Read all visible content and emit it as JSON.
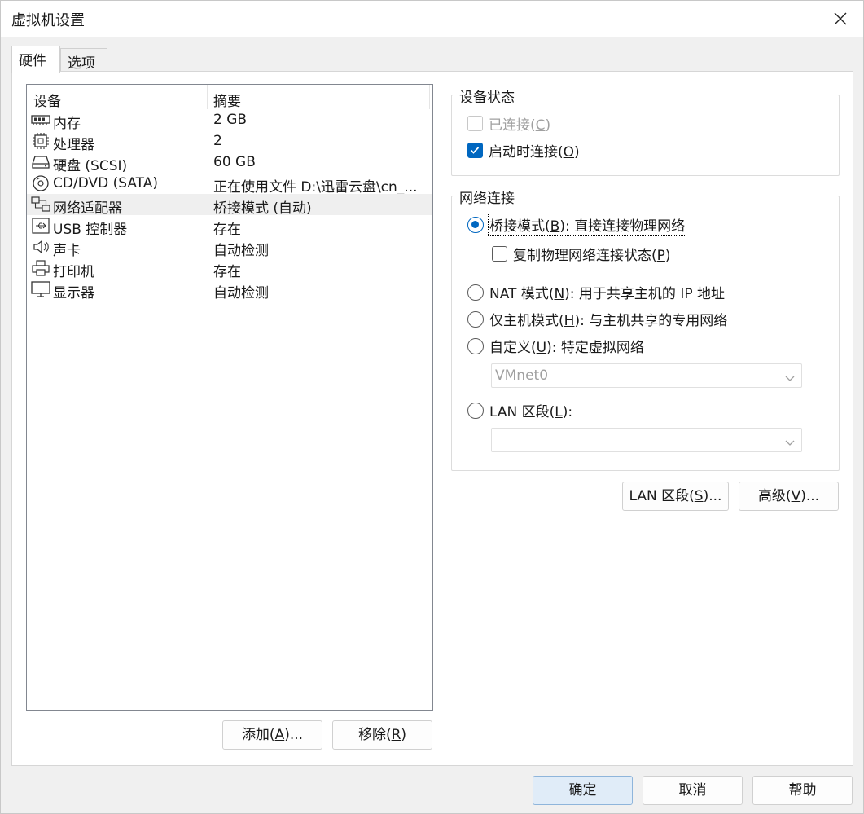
{
  "window": {
    "title": "虚拟机设置"
  },
  "tabs": {
    "hardware": "硬件",
    "options": "选项"
  },
  "device_list": {
    "col_device": "设备",
    "col_summary": "摘要",
    "rows": [
      {
        "icon": "memory-icon",
        "name": "内存",
        "summary": "2 GB"
      },
      {
        "icon": "processor-icon",
        "name": "处理器",
        "summary": "2"
      },
      {
        "icon": "harddisk-icon",
        "name": "硬盘 (SCSI)",
        "summary": "60 GB"
      },
      {
        "icon": "cd-dvd-icon",
        "name": "CD/DVD (SATA)",
        "summary": "正在使用文件 D:\\迅雷云盘\\cn_..."
      },
      {
        "icon": "network-adapter-icon",
        "name": "网络适配器",
        "summary": "桥接模式 (自动)"
      },
      {
        "icon": "usb-icon",
        "name": "USB 控制器",
        "summary": "存在"
      },
      {
        "icon": "sound-icon",
        "name": "声卡",
        "summary": "自动检测"
      },
      {
        "icon": "printer-icon",
        "name": "打印机",
        "summary": "存在"
      },
      {
        "icon": "display-icon",
        "name": "显示器",
        "summary": "自动检测"
      }
    ],
    "add_button": {
      "pre": "添加(",
      "key": "A",
      "post": ")..."
    },
    "remove_button": {
      "pre": "移除(",
      "key": "R",
      "post": ")"
    }
  },
  "device_status": {
    "label": "设备状态",
    "connected": {
      "pre": "已连接(",
      "key": "C",
      "post": ")",
      "checked": false,
      "enabled": false
    },
    "connect_on_start": {
      "pre": "启动时连接(",
      "key": "O",
      "post": ")",
      "checked": true
    }
  },
  "network": {
    "label": "网络连接",
    "bridged": {
      "pre": "桥接模式(",
      "key": "B",
      "post": "): 直接连接物理网络",
      "selected": true
    },
    "replicate": {
      "pre": "复制物理网络连接状态(",
      "key": "P",
      "post": ")",
      "checked": false
    },
    "nat": {
      "pre": "NAT 模式(",
      "key": "N",
      "post": "): 用于共享主机的 IP 地址",
      "selected": false
    },
    "hostonly": {
      "pre": "仅主机模式(",
      "key": "H",
      "post": "): 与主机共享的专用网络",
      "selected": false
    },
    "custom": {
      "pre": "自定义(",
      "key": "U",
      "post": "): 特定虚拟网络",
      "selected": false
    },
    "custom_select": "VMnet0",
    "lan": {
      "pre": "LAN 区段(",
      "key": "L",
      "post": "):",
      "selected": false
    },
    "lan_select": ""
  },
  "buttons": {
    "lan_segments": {
      "pre": "LAN 区段(",
      "key": "S",
      "post": ")..."
    },
    "advanced": {
      "pre": "高级(",
      "key": "V",
      "post": ")..."
    },
    "ok": "确定",
    "cancel": "取消",
    "help": "帮助"
  },
  "colors": {
    "accent": "#0067c0",
    "selected_row": "#efefef",
    "primary_button": "#e0ecf8"
  }
}
